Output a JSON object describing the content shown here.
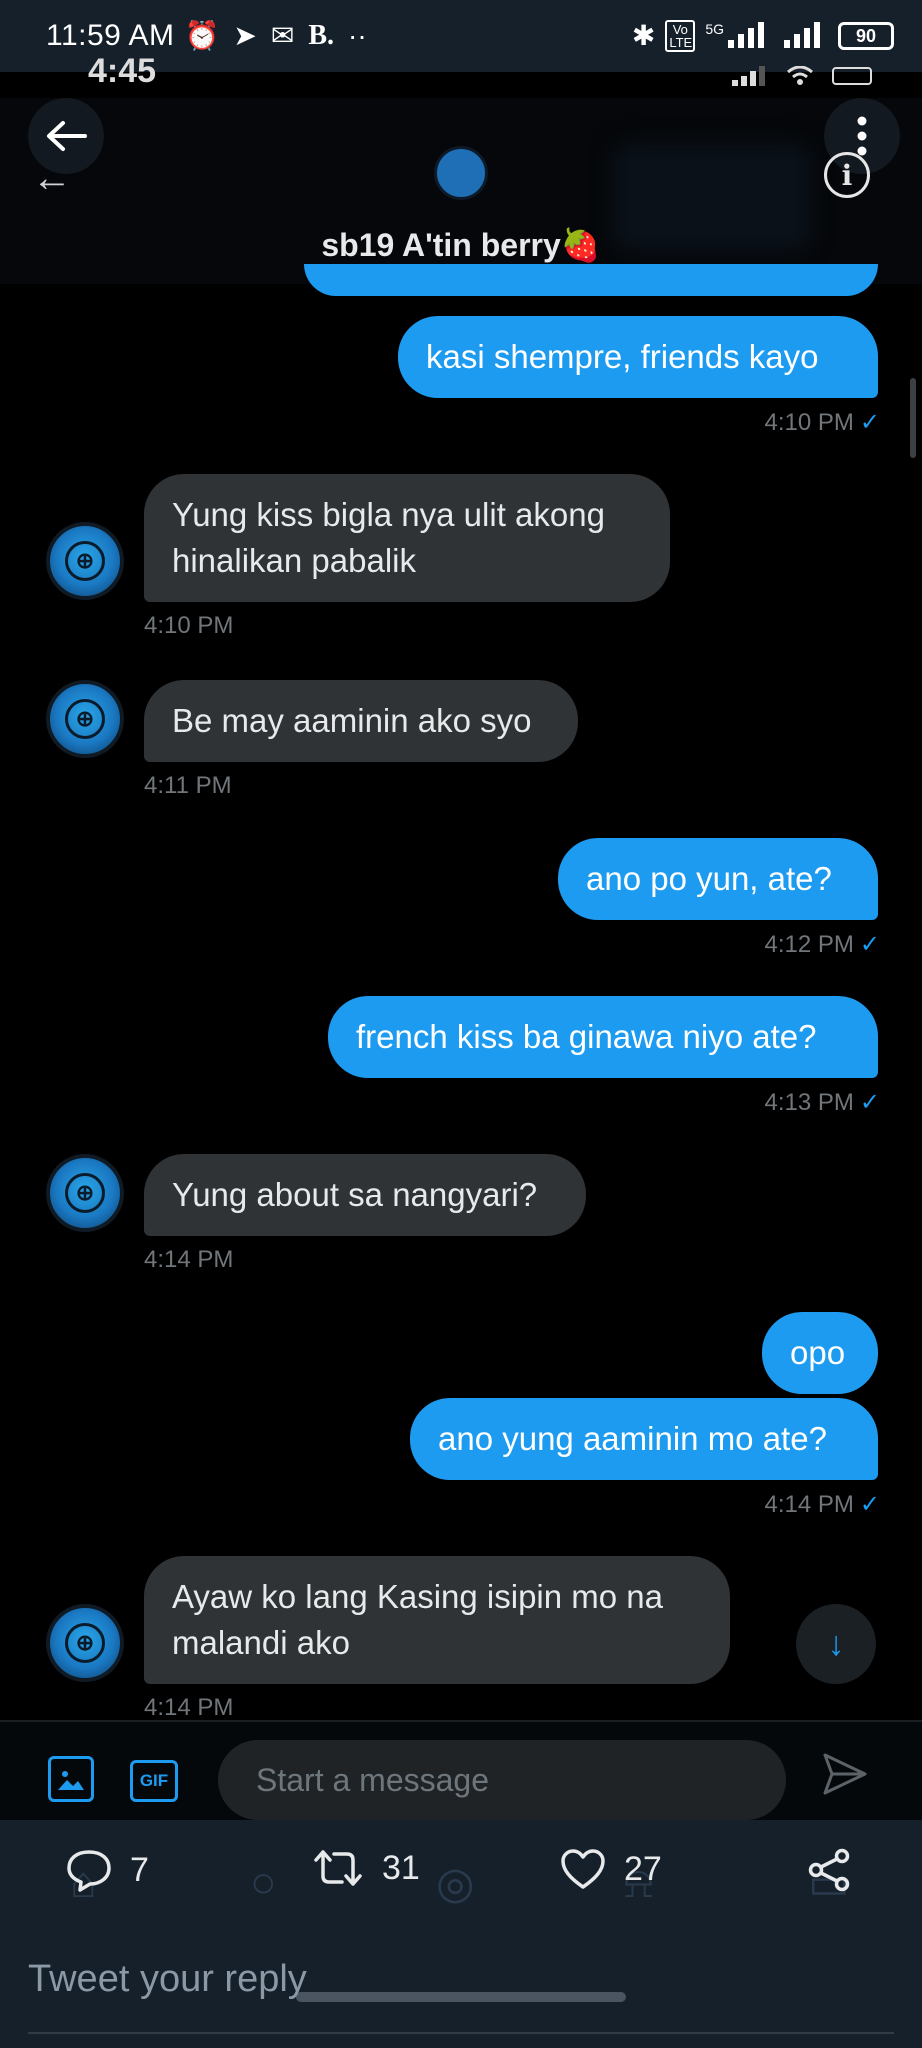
{
  "status_bar": {
    "time": "11:59 AM",
    "carrier_initial": "B.",
    "dots": "··",
    "network": "5G",
    "volte": "Vo LTE",
    "battery": "90"
  },
  "inner_status": {
    "time": "4:45"
  },
  "header": {
    "name": "sb19 A'tin berry🍓"
  },
  "messages": [
    {
      "text": "kasi shempre, friends kayo",
      "time": "4:10 PM",
      "check": "✓"
    },
    {
      "text": "Yung kiss bigla nya ulit akong",
      "text2": "hinalikan pabalik",
      "time": "4:10 PM"
    },
    {
      "text": "Be may aaminin ako syo",
      "time": "4:11 PM"
    },
    {
      "text": "ano po yun, ate?",
      "time": "4:12 PM",
      "check": "✓"
    },
    {
      "text": "french kiss ba ginawa niyo ate?",
      "time": "4:13 PM",
      "check": "✓"
    },
    {
      "text": "Yung about sa nangyari?",
      "time": "4:14 PM"
    },
    {
      "text": "opo"
    },
    {
      "text": "ano yung aaminin mo ate?",
      "time": "4:14 PM",
      "check": "✓"
    },
    {
      "text": "Ayaw ko lang Kasing isipin mo na",
      "text2": "malandi ako",
      "time": "4:14 PM"
    }
  ],
  "composer": {
    "placeholder": "Start a message",
    "gif_label": "GIF"
  },
  "tweet_actions": {
    "replies": "7",
    "retweets": "31",
    "likes": "27"
  },
  "reply_input": {
    "placeholder": "Tweet your reply"
  },
  "colors": {
    "accent": "#1d9bf0",
    "incoming_bubble": "#2f3336",
    "bar_bg": "#15202b"
  }
}
